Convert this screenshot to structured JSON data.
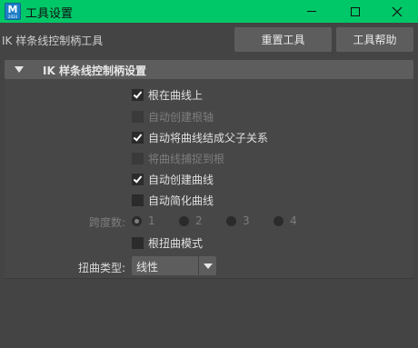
{
  "window": {
    "title": "工具设置",
    "app_icon_letter": "M",
    "app_icon_sub": "2024"
  },
  "header": {
    "tool_name": "IK 样条线控制柄工具",
    "reset_label": "重置工具",
    "help_label": "工具帮助"
  },
  "section": {
    "title": "IK 样条线控制柄设置",
    "options": [
      {
        "label": "根在曲线上",
        "checked": true,
        "enabled": true
      },
      {
        "label": "自动创建根轴",
        "checked": false,
        "enabled": false
      },
      {
        "label": "自动将曲线结成父子关系",
        "checked": true,
        "enabled": true
      },
      {
        "label": "将曲线捕捉到根",
        "checked": false,
        "enabled": false
      },
      {
        "label": "自动创建曲线",
        "checked": true,
        "enabled": true
      },
      {
        "label": "自动简化曲线",
        "checked": false,
        "enabled": true
      }
    ],
    "span": {
      "label": "跨度数:",
      "options": [
        "1",
        "2",
        "3",
        "4"
      ],
      "selected": "1",
      "enabled": false
    },
    "root_twist": {
      "label": "根扭曲模式",
      "checked": false,
      "enabled": true
    },
    "twist_type": {
      "label": "扭曲类型:",
      "value": "线性"
    }
  },
  "colors": {
    "titlebar": "#00c868",
    "background": "#444444",
    "button": "#5d5d5d"
  }
}
